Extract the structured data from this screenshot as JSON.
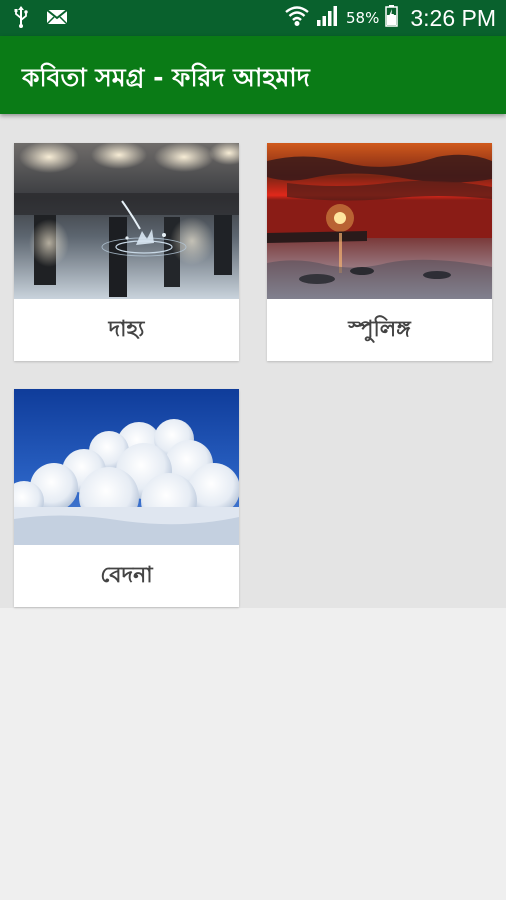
{
  "status_bar": {
    "icons": [
      "usb-icon",
      "mail-icon",
      "wifi-icon",
      "signal-icon",
      "battery-icon"
    ],
    "battery_percent": "58%",
    "time": "3:26 PM",
    "background": "#09612d"
  },
  "app_bar": {
    "title": "কবিতা সমগ্র - ফরিদ আহমাদ",
    "background": "#0a7b16"
  },
  "cards": [
    {
      "label": "দাহ্য",
      "image": "water-drop-image"
    },
    {
      "label": "স্পুলিঙ্গ",
      "image": "sunset-sea-image"
    },
    {
      "label": "বেদনা",
      "image": "clouds-sky-image"
    }
  ]
}
